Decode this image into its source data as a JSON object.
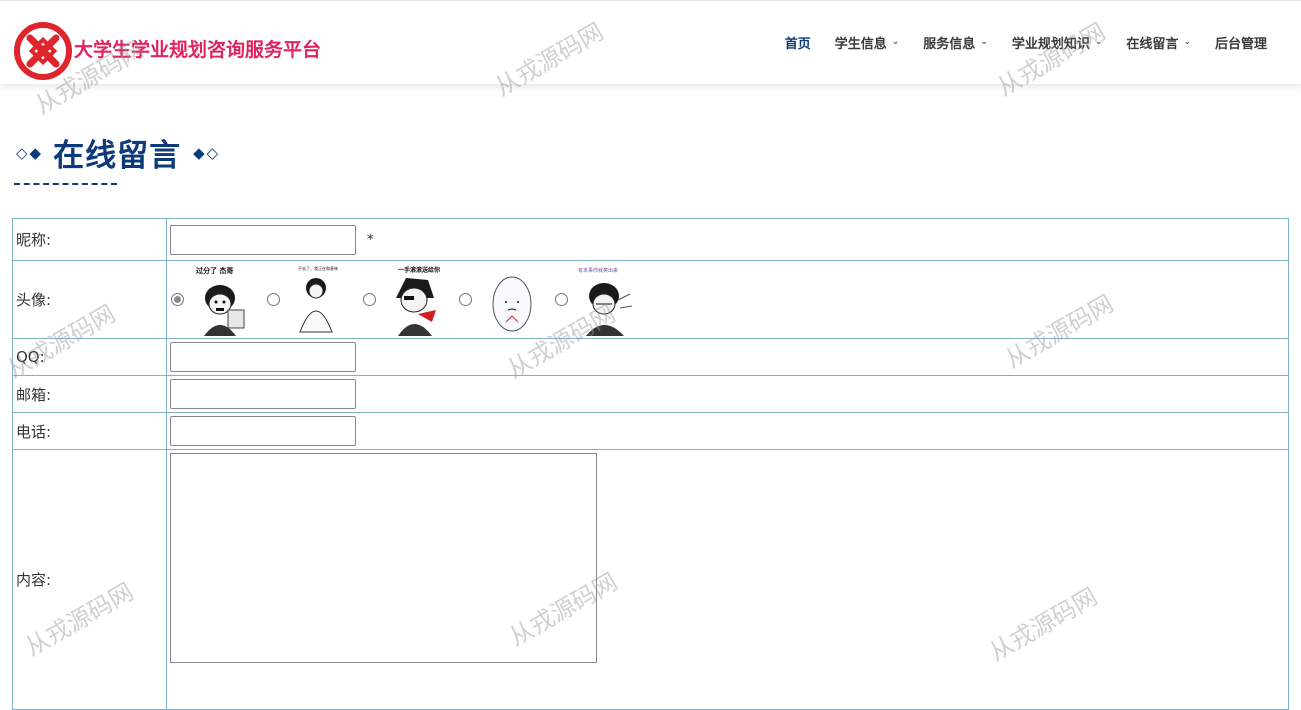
{
  "header": {
    "logo_text": "大学生学业规划咨询服务平台",
    "nav": [
      {
        "label": "首页",
        "active": true,
        "dropdown": false
      },
      {
        "label": "学生信息",
        "active": false,
        "dropdown": true
      },
      {
        "label": "服务信息",
        "active": false,
        "dropdown": true
      },
      {
        "label": "学业规划知识",
        "active": false,
        "dropdown": true
      },
      {
        "label": "在线留言",
        "active": false,
        "dropdown": true
      },
      {
        "label": "后台管理",
        "active": false,
        "dropdown": false
      }
    ]
  },
  "section": {
    "title": "在线留言",
    "left_deco": "◇◆",
    "right_deco": "◆◇"
  },
  "form": {
    "nickname_label": "昵称:",
    "nickname_value": "",
    "required_mark": "*",
    "avatar_label": "头像:",
    "avatars": [
      {
        "caption": "过分了 杰哥",
        "selected": true
      },
      {
        "caption": "不去了，我正在和意林",
        "selected": false
      },
      {
        "caption": "一手滚滚送给你",
        "selected": false
      },
      {
        "caption": "",
        "selected": false
      },
      {
        "caption": "有本事你就笑出来",
        "selected": false
      }
    ],
    "qq_label": "QQ:",
    "qq_value": "",
    "email_label": "邮箱:",
    "email_value": "",
    "phone_label": "电话:",
    "phone_value": "",
    "content_label": "内容:",
    "content_value": ""
  },
  "watermark": "从戎源码网",
  "colors": {
    "brand": "#e0245e",
    "primary": "#0c3a7a",
    "table_border": "#7fb0cc"
  }
}
